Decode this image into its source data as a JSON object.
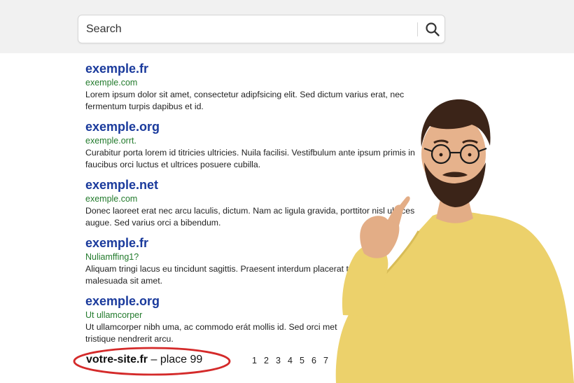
{
  "search": {
    "placeholder": "Search",
    "icon": "search-icon"
  },
  "results": [
    {
      "title": "exemple.fr",
      "url": "exemple.com",
      "snippet_1": "Lorem ipsum dolor sit amet, consectetur adipfsicing elit. Sed dictum varius erat, nec",
      "snippet_2": "fermentum turpis dapibus et id."
    },
    {
      "title": "exemple.org",
      "url": "exemple.orrt.",
      "snippet_1": "Curabitur porta lorem id titricies ultricies. Nuila facilisi. Vestifbulum ante ipsum primis in",
      "snippet_2": "faucibus orci luctus et ultrices posuere cubilla."
    },
    {
      "title": "exemple.net",
      "url": "exemple.com",
      "snippet_1": "Donec laoreet erat nec arcu laculis, dictum. Nam ac ligula gravida, porttitor nisl ultrices",
      "snippet_2": "augue. Sed varius orci a bibendum."
    },
    {
      "title": "exemple.fr",
      "url": "Nuliamffing1?",
      "snippet_1": "Aliquam tringi lacus eu tincidunt sagittis. Praesent interdum placerat to",
      "snippet_2": "malesuada sit amet."
    },
    {
      "title": "exemple.org",
      "url": "Ut ullamcorper",
      "snippet_1": "Ut ullamcorper nibh uma, ac commodo erát mollis id. Sed orci met",
      "snippet_2": "tristique nendrerit arcu."
    }
  ],
  "your_site": {
    "domain": "votre-site.fr",
    "rank_text": "– place 99"
  },
  "pagination": [
    "1",
    "2",
    "3",
    "4",
    "5",
    "6",
    "7"
  ],
  "colors": {
    "title_blue": "#1a3a9c",
    "url_green": "#237b2d",
    "highlight_red": "#d42a2a",
    "shirt_yellow": "#ecd16b"
  }
}
